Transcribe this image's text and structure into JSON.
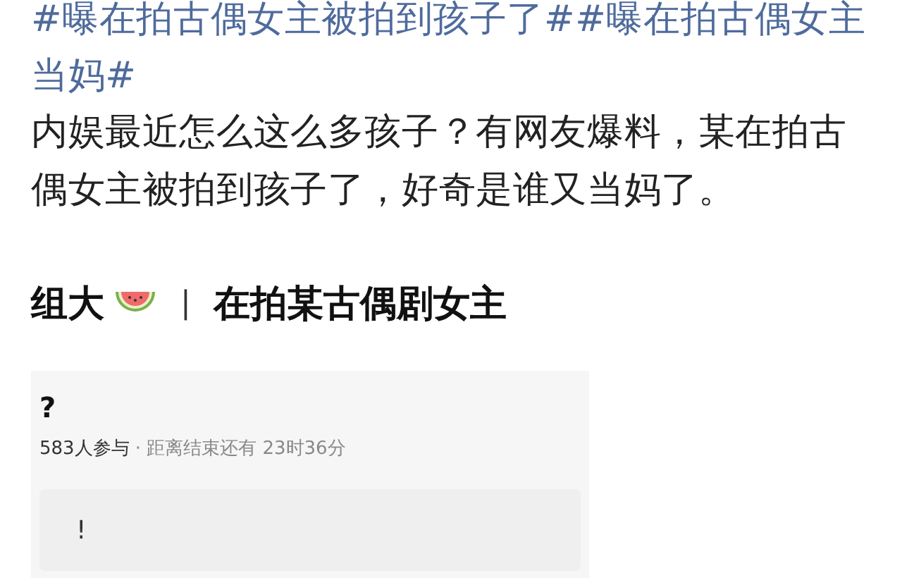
{
  "post": {
    "topics": "#曝在拍古偶女主被拍到孩子了##曝在拍古偶女主当妈#",
    "body": "内娱最近怎么这么多孩子？有网友爆料，某在拍古偶女主被拍到孩子了，好奇是谁又当妈了。"
  },
  "quote": {
    "author": "组大",
    "separator": "|",
    "title": "在拍某古偶剧女主"
  },
  "poll": {
    "question": "?",
    "participants": "583人参与",
    "deadline": "· 距离结束还有 23时36分",
    "options": [
      {
        "label": "!"
      }
    ]
  }
}
